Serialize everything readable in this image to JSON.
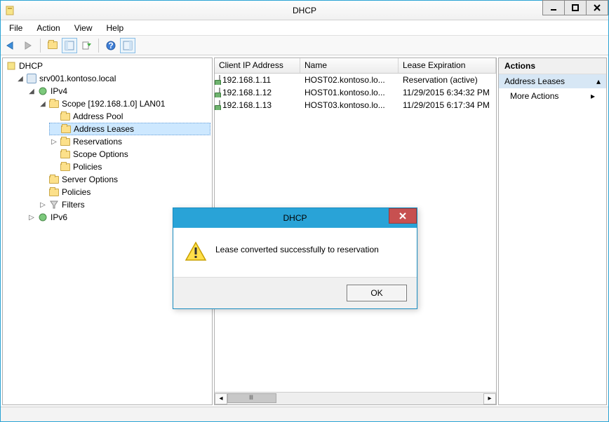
{
  "title": "DHCP",
  "menus": [
    "File",
    "Action",
    "View",
    "Help"
  ],
  "tree": {
    "root": "DHCP",
    "server": "srv001.kontoso.local",
    "ipv4": "IPv4",
    "scope": "Scope [192.168.1.0] LAN01",
    "addressPool": "Address Pool",
    "addressLeases": "Address Leases",
    "reservations": "Reservations",
    "scopeOptions": "Scope Options",
    "policies": "Policies",
    "serverOptions": "Server Options",
    "policies2": "Policies",
    "filters": "Filters",
    "ipv6": "IPv6"
  },
  "columns": {
    "ip": "Client IP Address",
    "name": "Name",
    "lease": "Lease Expiration"
  },
  "rows": [
    {
      "ip": "192.168.1.11",
      "name": "HOST02.kontoso.lo...",
      "lease": "Reservation (active)"
    },
    {
      "ip": "192.168.1.12",
      "name": "HOST01.kontoso.lo...",
      "lease": "11/29/2015 6:34:32 PM"
    },
    {
      "ip": "192.168.1.13",
      "name": "HOST03.kontoso.lo...",
      "lease": "11/29/2015 6:17:34 PM"
    }
  ],
  "actions": {
    "hdr": "Actions",
    "section": "Address Leases",
    "more": "More Actions"
  },
  "dialog": {
    "title": "DHCP",
    "msg": "Lease converted successfully to reservation",
    "ok": "OK"
  }
}
